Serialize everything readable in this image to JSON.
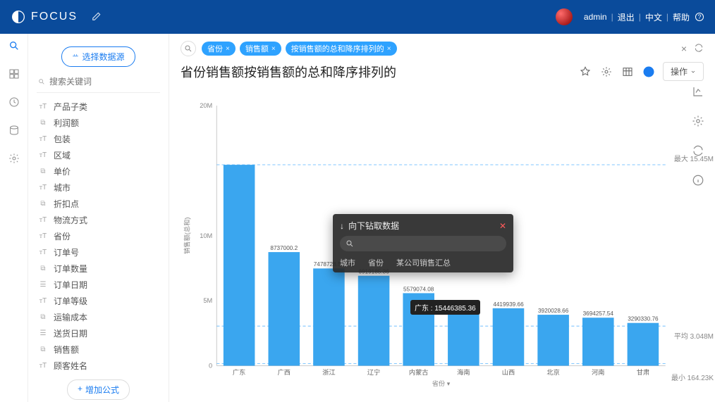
{
  "app": {
    "name": "FOCUS"
  },
  "topnav": {
    "user": "admin",
    "logout": "退出",
    "lang": "中文",
    "help": "帮助"
  },
  "sidebar": {
    "select_source": "选择数据源",
    "search_placeholder": "搜索关键词",
    "add_formula": "增加公式",
    "fields": [
      {
        "type": "T",
        "label": "产品子类"
      },
      {
        "type": "#",
        "label": "利润额"
      },
      {
        "type": "T",
        "label": "包装"
      },
      {
        "type": "T",
        "label": "区域"
      },
      {
        "type": "#",
        "label": "单价"
      },
      {
        "type": "T",
        "label": "城市"
      },
      {
        "type": "#",
        "label": "折扣点"
      },
      {
        "type": "T",
        "label": "物流方式"
      },
      {
        "type": "T",
        "label": "省份"
      },
      {
        "type": "T",
        "label": "订单号"
      },
      {
        "type": "#",
        "label": "订单数量"
      },
      {
        "type": "D",
        "label": "订单日期"
      },
      {
        "type": "T",
        "label": "订单等级"
      },
      {
        "type": "#",
        "label": "运输成本"
      },
      {
        "type": "D",
        "label": "送货日期"
      },
      {
        "type": "#",
        "label": "销售额"
      },
      {
        "type": "T",
        "label": "顾客姓名"
      }
    ]
  },
  "query": {
    "chips": [
      "省份",
      "销售额",
      "按销售额的总和降序排列的"
    ]
  },
  "page": {
    "title": "省份销售额按销售额的总和降序排列的",
    "op_button": "操作"
  },
  "drill": {
    "title": "向下钻取数据",
    "cols": [
      "城市",
      "省份",
      "某公司销售汇总"
    ]
  },
  "tooltip": {
    "text": "广东 : 15446385.36"
  },
  "chart_axis": {
    "ylabel": "销售额(总和)",
    "xlabel": "省份",
    "ytop": "20M",
    "refs": {
      "max": "最大 15.45M",
      "avg": "平均 3.048M",
      "min": "最小 164.23K"
    }
  },
  "chart_data": {
    "type": "bar",
    "title": "省份销售额按销售额的总和降序排列的",
    "xlabel": "省份",
    "ylabel": "销售额(总和)",
    "ylim": [
      0,
      20000000
    ],
    "yticks": [
      "0",
      "5M",
      "10M",
      "20M"
    ],
    "ref_lines": {
      "max": 15450000,
      "avg": 3048000,
      "min": 164230
    },
    "categories": [
      "广东",
      "广西",
      "浙江",
      "辽宁",
      "内蒙古",
      "海南",
      "山西",
      "北京",
      "河南",
      "甘肃"
    ],
    "values": [
      15446385.36,
      8737000.2,
      7478728.56,
      6919185.36,
      5579074.08,
      4468243.74,
      4419939.66,
      3920028.66,
      3694257.54,
      3290330.76
    ],
    "value_labels": [
      "",
      "8737000.2",
      "7478728.56",
      "6919185.36",
      "5579074.08",
      "4468243.74",
      "4419939.66",
      "3920028.66",
      "3694257.54",
      "3290330.76"
    ]
  }
}
